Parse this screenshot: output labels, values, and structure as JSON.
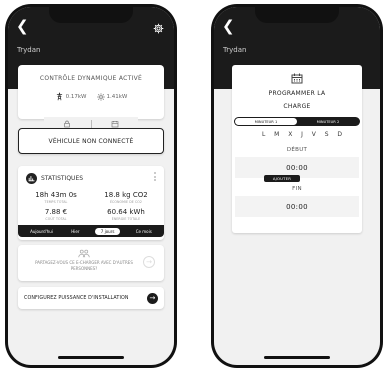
{
  "left_screen": {
    "title": "Trydan",
    "dynamic_control": {
      "title": "CONTRÔLE DYNAMIQUE ACTIVÉ",
      "grid_power": "0.17kW",
      "solar_power": "1.41kW"
    },
    "vehicle_status": "VÉHICULE NON CONNECTÉ",
    "statistics": {
      "title": "STATISTIQUES",
      "items": [
        {
          "value": "18h 43m 0s",
          "label": "TEMPS TOTAL"
        },
        {
          "value": "18.8 kg CO2",
          "label": "ÉCONOMIE DE CO2"
        },
        {
          "value": "7.88 €",
          "label": "COÛT TOTAL"
        },
        {
          "value": "60.64 kWh",
          "label": "ÉNERGIE TOTALE"
        }
      ],
      "periods": [
        "Aujourd'hui",
        "Hier",
        "7 jours",
        "Ce mois"
      ],
      "active_period": "7 jours"
    },
    "share": {
      "text": "PARTAGEZ-VOUS CE E-CHARGER AVEC D'AUTRES PERSONNES?"
    },
    "config_button": "CONFIGUREZ PUISSANCE D'INSTALLATION"
  },
  "right_screen": {
    "title": "Trydan",
    "program_title_line1": "PROGRAMMER LA",
    "program_title_line2": "CHARGE",
    "timers": [
      "MINUTEUR 1",
      "MINUTEUR 2"
    ],
    "active_timer": "MINUTEUR 1",
    "days": [
      "L",
      "M",
      "X",
      "J",
      "V",
      "S",
      "D"
    ],
    "start_label": "DÉBUT",
    "start_time": "00:00",
    "end_label": "FIN",
    "end_time": "00:00",
    "add_button": "AJOUTER"
  }
}
